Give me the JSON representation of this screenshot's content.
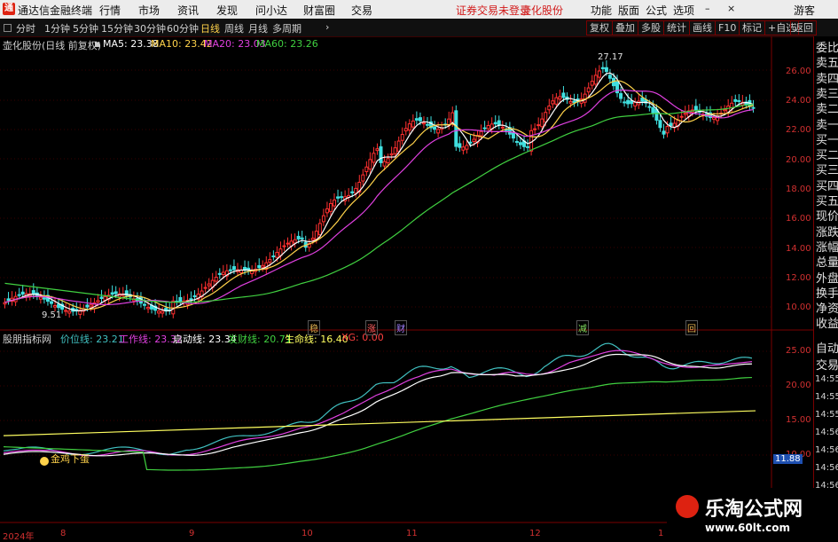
{
  "app": {
    "title": "通达信金融终端",
    "menus": [
      "行情",
      "市场",
      "资讯",
      "发现",
      "问小达",
      "财富圈",
      "交易"
    ],
    "notice": "证券交易未登录",
    "stock_menu": "壶化股份",
    "right_menus": [
      "功能",
      "版面",
      "公式",
      "选项"
    ],
    "user": "游客"
  },
  "toolbar": {
    "periods": [
      "分时",
      "1分钟",
      "5分钟",
      "15分钟",
      "30分钟",
      "60分钟",
      "日线",
      "周线",
      "月线",
      "多周期"
    ],
    "selected": "日线",
    "more": "›",
    "buttons": [
      "复权",
      "叠加",
      "多股",
      "统计",
      "画线",
      "F10",
      "标记",
      "+自选",
      "返回"
    ]
  },
  "main_header": {
    "name": "壶化股份(日线 前复权)",
    "ma": [
      {
        "label": "MA5: 23.38",
        "color": "#ffffff"
      },
      {
        "label": "MA10: 23.42",
        "color": "#ffd24a"
      },
      {
        "label": "MA20: 23.03",
        "color": "#e040e0"
      },
      {
        "label": "MA60: 23.26",
        "color": "#40d040"
      }
    ]
  },
  "sub_header": {
    "name": "股朋指标网",
    "lines": [
      {
        "label": "价位线: 23.21",
        "color": "#40c0c0"
      },
      {
        "label": "工作线: 23.32",
        "color": "#e040e0"
      },
      {
        "label": "启动线: 23.34",
        "color": "#ffffff"
      },
      {
        "label": "发财线: 20.71",
        "color": "#40d040"
      },
      {
        "label": "生命线: 16.40",
        "color": "#ffff60"
      },
      {
        "label": "XG: 0.00",
        "color": "#ff4040"
      }
    ]
  },
  "main_axis": [
    "26.00",
    "24.00",
    "22.00",
    "20.00",
    "18.00",
    "16.00",
    "14.00",
    "12.00",
    "10.00"
  ],
  "sub_axis": [
    "25.00",
    "20.00",
    "15.00",
    "10.00"
  ],
  "price_tag": "11.88",
  "annotations": {
    "high": "27.17",
    "low": "9.51",
    "signal": "金鸡下蛋",
    "markers": [
      {
        "text": "稳",
        "color": "#e0b050"
      },
      {
        "text": "涨",
        "color": "#ff6060"
      },
      {
        "text": "财",
        "color": "#a080ff"
      },
      {
        "text": "减",
        "color": "#80e060"
      },
      {
        "text": "回",
        "color": "#e0b050"
      }
    ]
  },
  "date_axis": [
    "2024年",
    "8",
    "9",
    "10",
    "11",
    "12",
    "1"
  ],
  "right_panel": {
    "items": [
      "委比",
      "卖五",
      "卖四",
      "卖三",
      "卖二",
      "卖一",
      "买一",
      "买二",
      "买三",
      "买四",
      "买五",
      "现价",
      "涨跌",
      "涨幅",
      "总量",
      "外盘",
      "换手",
      "净资",
      "收益"
    ],
    "sub_items": [
      "自动",
      "交易"
    ],
    "times": [
      "14:55",
      "14:55",
      "14:55",
      "14:56",
      "14:56",
      "14:56",
      "14:56",
      "14:56"
    ]
  },
  "watermark": {
    "title": "乐淘公式网",
    "url": "www.60lt.com"
  },
  "colors": {
    "up": "#ff3030",
    "down": "#40e0e0",
    "axis": "#7a0000"
  }
}
